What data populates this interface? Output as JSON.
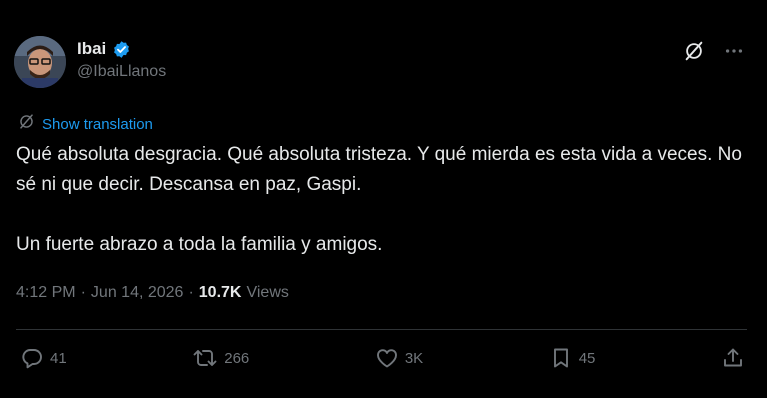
{
  "author": {
    "name": "Ibai",
    "handle": "@IbaiLlanos",
    "verified_color": "#1d9bf0"
  },
  "translation": {
    "label": "Show translation"
  },
  "tweet": {
    "paragraph_1": "Qué absoluta desgracia. Qué absoluta tristeza. Y qué mierda es esta vida a veces. No sé ni que decir. Descansa en paz, Gaspi.",
    "paragraph_2": "Un fuerte abrazo a toda la familia y amigos."
  },
  "meta": {
    "time": "4:12 PM",
    "separator": "·",
    "date": "Jun 14, 2026",
    "views_count": "10.7K",
    "views_label": "Views"
  },
  "actions": {
    "replies": "41",
    "reposts": "266",
    "likes": "3K",
    "bookmarks": "45"
  },
  "icons": {
    "grok": "grok-icon",
    "more": "more-dots-icon",
    "translate": "translate-icon",
    "reply": "reply-icon",
    "repost": "repost-icon",
    "like": "heart-icon",
    "bookmark": "bookmark-icon",
    "share": "share-icon"
  },
  "colors": {
    "background": "#000000",
    "text": "#e7e9ea",
    "secondary": "#71767b",
    "accent": "#1d9bf0",
    "divider": "#2f3336"
  }
}
